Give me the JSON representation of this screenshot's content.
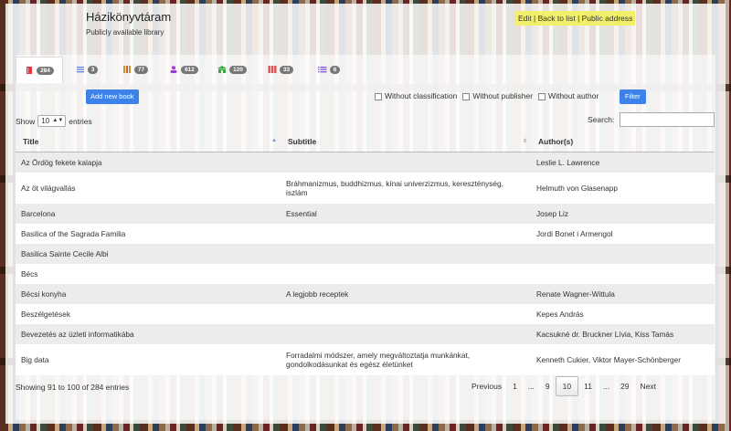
{
  "header": {
    "title": "Házikönyvtáram",
    "subtitle": "Publicly available library"
  },
  "toplinks": {
    "edit": "Edit",
    "sep": " | ",
    "back": "Back to list",
    "public": "Public address"
  },
  "tabs": [
    {
      "icon": "book-icon",
      "color": "#e8363b",
      "count": "284"
    },
    {
      "icon": "list-icon",
      "color": "#6c8fdb",
      "count": "3"
    },
    {
      "icon": "books-icon",
      "color": "#d08a3a",
      "count": "77"
    },
    {
      "icon": "user-icon",
      "color": "#9b3bd6",
      "count": "612"
    },
    {
      "icon": "building-icon",
      "color": "#3aa84a",
      "count": "120"
    },
    {
      "icon": "series-icon",
      "color": "#e05050",
      "count": "33"
    },
    {
      "icon": "tag-list-icon",
      "color": "#8a5ad6",
      "count": "6"
    }
  ],
  "toolbar": {
    "add_book": "Add new book",
    "filter": "Filter"
  },
  "filters": [
    "Without classification",
    "Without publisher",
    "Without author"
  ],
  "table_controls": {
    "show": "Show",
    "page_size": "10",
    "entries": "entries",
    "search": "Search:"
  },
  "columns": [
    "Title",
    "Subtitle",
    "Author(s)"
  ],
  "rows": [
    {
      "title": "Az Ördög fekete kalapja",
      "subtitle": "",
      "author": "Leslie L. Lawrence"
    },
    {
      "title": "Az öt világvallás",
      "subtitle": "Bráhmanizmus, buddhizmus, kínai univerzizmus, kereszténység, iszlám",
      "author": "Helmuth von Glasenapp"
    },
    {
      "title": "Barcelona",
      "subtitle": "Essential",
      "author": "Josep Liz"
    },
    {
      "title": "Basilica of the Sagrada Familia",
      "subtitle": "",
      "author": "Jordi Bonet i Armengol"
    },
    {
      "title": "Basilica Sainte Cecile Albi",
      "subtitle": "",
      "author": ""
    },
    {
      "title": "Bécs",
      "subtitle": "",
      "author": ""
    },
    {
      "title": "Bécsi konyha",
      "subtitle": "A legjobb receptek",
      "author": "Renate Wagner-Wittula"
    },
    {
      "title": "Beszélgetések",
      "subtitle": "",
      "author": "Kepes András"
    },
    {
      "title": "Bevezetés az üzleti informatikába",
      "subtitle": "",
      "author": "Kacsukné dr. Bruckner Lívia, Kiss Tamás"
    },
    {
      "title": "Big data",
      "subtitle": "Forradalmi módszer, amely megváltoztatja munkánkat, gondolkodásunkat és egész életünket",
      "author": "Kenneth Cukier, Viktor Mayer-Schönberger"
    }
  ],
  "footer": {
    "info": "Showing 91 to 100 of 284 entries",
    "pager": [
      "Previous",
      "1",
      "...",
      "9",
      "10",
      "11",
      "...",
      "29",
      "Next"
    ],
    "current": "10"
  }
}
